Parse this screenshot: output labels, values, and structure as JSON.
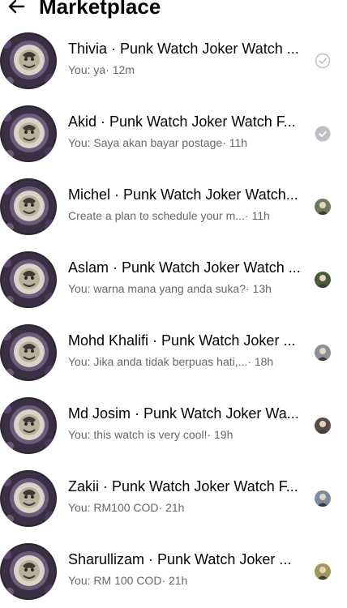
{
  "header": {
    "title": "Marketplace",
    "back_icon": "arrow-left-icon"
  },
  "colors": {
    "text": "#050505",
    "secondary": "#65676b",
    "sent_check": "#bcc0c4"
  },
  "conversations": [
    {
      "name": "Thivia · Punk Watch Joker Watch ...",
      "message": "You: ya",
      "time": " · 12m",
      "status": "sent-outline-check-icon",
      "mini_color": ""
    },
    {
      "name": "Akid · Punk Watch Joker Watch F...",
      "message": "You: Saya akan bayar postage",
      "time": " · 11h",
      "status": "sent-filled-check-icon",
      "mini_color": ""
    },
    {
      "name": "Michel · Punk Watch Joker Watch...",
      "message": "Create a plan to schedule your m...",
      "time": " · 11h",
      "status": "seen-avatar-icon",
      "mini_color": "#6b7a5a"
    },
    {
      "name": "Aslam · Punk Watch Joker Watch ...",
      "message": "You: warna mana yang anda suka?",
      "time": " · 13h",
      "status": "seen-avatar-icon",
      "mini_color": "#4a5a3a"
    },
    {
      "name": "Mohd Khalifi · Punk Watch Joker ...",
      "message": "You: Jika anda tidak berpuas hati,...",
      "time": " · 18h",
      "status": "seen-avatar-icon",
      "mini_color": "#8a8f99"
    },
    {
      "name": "Md Josim · Punk Watch Joker Wa...",
      "message": "You: this watch is very cool!",
      "time": " · 19h",
      "status": "seen-avatar-icon",
      "mini_color": "#5a4a44"
    },
    {
      "name": "Zakii · Punk Watch Joker Watch F...",
      "message": "You: RM100 COD",
      "time": " · 21h",
      "status": "seen-avatar-icon",
      "mini_color": "#7b8a9c"
    },
    {
      "name": "Sharullizam · Punk Watch Joker ...",
      "message": "You: RM 100 COD",
      "time": " · 21h",
      "status": "seen-avatar-icon",
      "mini_color": "#9a9a5a"
    }
  ]
}
